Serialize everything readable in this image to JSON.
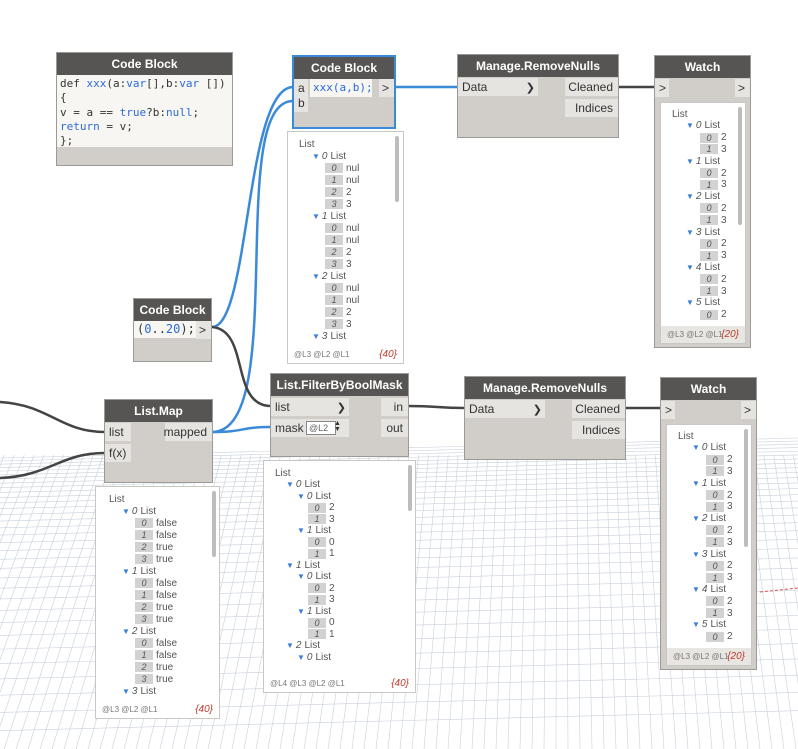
{
  "nodes": {
    "code_block_def": {
      "title": "Code Block",
      "lines": [
        "def xxx(a:var[],b:var [])",
        "{",
        "v = a == true?b:null;",
        "return = v;",
        "};"
      ]
    },
    "code_block_call": {
      "title": "Code Block",
      "in_a": "a",
      "in_b": "b",
      "code": "xxx(a,b);",
      "out": ">"
    },
    "code_block_range": {
      "title": "Code Block",
      "code": "(0..20);",
      "out": ">"
    },
    "list_map": {
      "title": "List.Map",
      "in_list": "list",
      "in_fx": "f(x)",
      "out_mapped": "mapped"
    },
    "filter_mask": {
      "title": "List.FilterByBoolMask",
      "in_list": "list",
      "in_mask": "mask",
      "mask_level": "@L2",
      "out_in": "in",
      "out_out": "out"
    },
    "remove_nulls_top": {
      "title": "Manage.RemoveNulls",
      "in_data": "Data",
      "out_cleaned": "Cleaned",
      "out_indices": "Indices"
    },
    "remove_nulls_bottom": {
      "title": "Manage.RemoveNulls",
      "in_data": "Data",
      "out_cleaned": "Cleaned",
      "out_indices": "Indices"
    },
    "watch_top": {
      "title": "Watch",
      "in": ">",
      "out": ">"
    },
    "watch_bottom": {
      "title": "Watch",
      "in": ">",
      "out": ">"
    }
  },
  "previews": {
    "call_preview": {
      "levels": "@L3 @L2 @L1",
      "count": "{40}",
      "rows": [
        {
          "d": 0,
          "t": "List"
        },
        {
          "d": 1,
          "g": "0",
          "t": "List"
        },
        {
          "d": 2,
          "i": "0",
          "t": "nul"
        },
        {
          "d": 2,
          "i": "1",
          "t": "nul"
        },
        {
          "d": 2,
          "i": "2",
          "t": "2"
        },
        {
          "d": 2,
          "i": "3",
          "t": "3"
        },
        {
          "d": 1,
          "g": "1",
          "t": "List"
        },
        {
          "d": 2,
          "i": "0",
          "t": "nul"
        },
        {
          "d": 2,
          "i": "1",
          "t": "nul"
        },
        {
          "d": 2,
          "i": "2",
          "t": "2"
        },
        {
          "d": 2,
          "i": "3",
          "t": "3"
        },
        {
          "d": 1,
          "g": "2",
          "t": "List"
        },
        {
          "d": 2,
          "i": "0",
          "t": "nul"
        },
        {
          "d": 2,
          "i": "1",
          "t": "nul"
        },
        {
          "d": 2,
          "i": "2",
          "t": "2"
        },
        {
          "d": 2,
          "i": "3",
          "t": "3"
        },
        {
          "d": 1,
          "g": "3",
          "t": "List"
        }
      ]
    },
    "watch_top_preview": {
      "levels": "@L3 @L2 @L1",
      "count": "{20}",
      "rows": [
        {
          "d": 0,
          "t": "List"
        },
        {
          "d": 1,
          "g": "0",
          "t": "List"
        },
        {
          "d": 2,
          "i": "0",
          "t": "2"
        },
        {
          "d": 2,
          "i": "1",
          "t": "3"
        },
        {
          "d": 1,
          "g": "1",
          "t": "List"
        },
        {
          "d": 2,
          "i": "0",
          "t": "2"
        },
        {
          "d": 2,
          "i": "1",
          "t": "3"
        },
        {
          "d": 1,
          "g": "2",
          "t": "List"
        },
        {
          "d": 2,
          "i": "0",
          "t": "2"
        },
        {
          "d": 2,
          "i": "1",
          "t": "3"
        },
        {
          "d": 1,
          "g": "3",
          "t": "List"
        },
        {
          "d": 2,
          "i": "0",
          "t": "2"
        },
        {
          "d": 2,
          "i": "1",
          "t": "3"
        },
        {
          "d": 1,
          "g": "4",
          "t": "List"
        },
        {
          "d": 2,
          "i": "0",
          "t": "2"
        },
        {
          "d": 2,
          "i": "1",
          "t": "3"
        },
        {
          "d": 1,
          "g": "5",
          "t": "List"
        },
        {
          "d": 2,
          "i": "0",
          "t": "2"
        }
      ]
    },
    "watch_bottom_preview": {
      "levels": "@L3 @L2 @L1",
      "count": "{20}",
      "rows": [
        {
          "d": 0,
          "t": "List"
        },
        {
          "d": 1,
          "g": "0",
          "t": "List"
        },
        {
          "d": 2,
          "i": "0",
          "t": "2"
        },
        {
          "d": 2,
          "i": "1",
          "t": "3"
        },
        {
          "d": 1,
          "g": "1",
          "t": "List"
        },
        {
          "d": 2,
          "i": "0",
          "t": "2"
        },
        {
          "d": 2,
          "i": "1",
          "t": "3"
        },
        {
          "d": 1,
          "g": "2",
          "t": "List"
        },
        {
          "d": 2,
          "i": "0",
          "t": "2"
        },
        {
          "d": 2,
          "i": "1",
          "t": "3"
        },
        {
          "d": 1,
          "g": "3",
          "t": "List"
        },
        {
          "d": 2,
          "i": "0",
          "t": "2"
        },
        {
          "d": 2,
          "i": "1",
          "t": "3"
        },
        {
          "d": 1,
          "g": "4",
          "t": "List"
        },
        {
          "d": 2,
          "i": "0",
          "t": "2"
        },
        {
          "d": 2,
          "i": "1",
          "t": "3"
        },
        {
          "d": 1,
          "g": "5",
          "t": "List"
        },
        {
          "d": 2,
          "i": "0",
          "t": "2"
        }
      ]
    },
    "map_preview": {
      "levels": "@L3 @L2 @L1",
      "count": "{40}",
      "rows": [
        {
          "d": 0,
          "t": "List"
        },
        {
          "d": 1,
          "g": "0",
          "t": "List"
        },
        {
          "d": 2,
          "i": "0",
          "t": "false"
        },
        {
          "d": 2,
          "i": "1",
          "t": "false"
        },
        {
          "d": 2,
          "i": "2",
          "t": "true"
        },
        {
          "d": 2,
          "i": "3",
          "t": "true"
        },
        {
          "d": 1,
          "g": "1",
          "t": "List"
        },
        {
          "d": 2,
          "i": "0",
          "t": "false"
        },
        {
          "d": 2,
          "i": "1",
          "t": "false"
        },
        {
          "d": 2,
          "i": "2",
          "t": "true"
        },
        {
          "d": 2,
          "i": "3",
          "t": "true"
        },
        {
          "d": 1,
          "g": "2",
          "t": "List"
        },
        {
          "d": 2,
          "i": "0",
          "t": "false"
        },
        {
          "d": 2,
          "i": "1",
          "t": "false"
        },
        {
          "d": 2,
          "i": "2",
          "t": "true"
        },
        {
          "d": 2,
          "i": "3",
          "t": "true"
        },
        {
          "d": 1,
          "g": "3",
          "t": "List"
        }
      ]
    },
    "filter_preview": {
      "levels": "@L4 @L3 @L2 @L1",
      "count": "{40}",
      "rows": [
        {
          "d": 0,
          "t": "List"
        },
        {
          "d": 1,
          "g": "0",
          "t": "List"
        },
        {
          "d": 2,
          "g": "0",
          "t": "List"
        },
        {
          "d": 3,
          "i": "0",
          "t": "2"
        },
        {
          "d": 3,
          "i": "1",
          "t": "3"
        },
        {
          "d": 2,
          "g": "1",
          "t": "List"
        },
        {
          "d": 3,
          "i": "0",
          "t": "0"
        },
        {
          "d": 3,
          "i": "1",
          "t": "1"
        },
        {
          "d": 1,
          "g": "1",
          "t": "List"
        },
        {
          "d": 2,
          "g": "0",
          "t": "List"
        },
        {
          "d": 3,
          "i": "0",
          "t": "2"
        },
        {
          "d": 3,
          "i": "1",
          "t": "3"
        },
        {
          "d": 2,
          "g": "1",
          "t": "List"
        },
        {
          "d": 3,
          "i": "0",
          "t": "0"
        },
        {
          "d": 3,
          "i": "1",
          "t": "1"
        },
        {
          "d": 1,
          "g": "2",
          "t": "List"
        },
        {
          "d": 2,
          "g": "0",
          "t": "List"
        }
      ]
    }
  },
  "colors": {
    "wire_selected": "#3b8ad9",
    "wire": "#444444",
    "node_header": "#565553",
    "node_body": "#d1cec9"
  }
}
